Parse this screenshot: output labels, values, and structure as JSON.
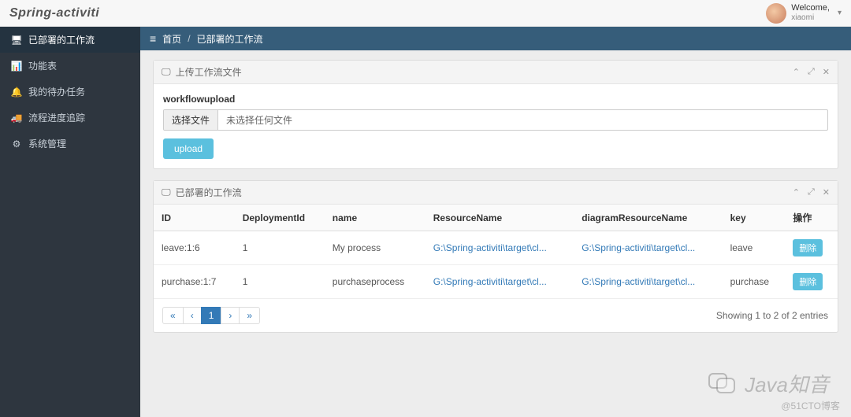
{
  "brand": "Spring-activiti",
  "user": {
    "welcome": "Welcome,",
    "name": "xiaomi"
  },
  "sidebar": {
    "items": [
      {
        "icon": "dashboard-icon",
        "glyph": "🖥",
        "label": "已部署的工作流"
      },
      {
        "icon": "chart-icon",
        "glyph": "📊",
        "label": "功能表"
      },
      {
        "icon": "bell-icon",
        "glyph": "🔔",
        "label": "我的待办任务"
      },
      {
        "icon": "truck-icon",
        "glyph": "🚚",
        "label": "流程进度追踪"
      },
      {
        "icon": "gear-icon",
        "glyph": "⚙",
        "label": "系统管理"
      }
    ]
  },
  "breadcrumb": {
    "home": "首页",
    "current": "已部署的工作流"
  },
  "uploadPanel": {
    "title": "上传工作流文件",
    "formLabel": "workflowupload",
    "chooseFile": "选择文件",
    "noFile": "未选择任何文件",
    "uploadBtn": "upload"
  },
  "tablePanel": {
    "title": "已部署的工作流",
    "headers": {
      "id": "ID",
      "deploymentId": "DeploymentId",
      "name": "name",
      "resourceName": "ResourceName",
      "diagramResourceName": "diagramResourceName",
      "key": "key",
      "action": "操作"
    },
    "rows": [
      {
        "id": "leave:1:6",
        "deploymentId": "1",
        "name": "My process",
        "resourceName": "G:\\Spring-activiti\\target\\cl...",
        "diagramResourceName": "G:\\Spring-activiti\\target\\cl...",
        "key": "leave",
        "action": "删除"
      },
      {
        "id": "purchase:1:7",
        "deploymentId": "1",
        "name": "purchaseprocess",
        "resourceName": "G:\\Spring-activiti\\target\\cl...",
        "diagramResourceName": "G:\\Spring-activiti\\target\\cl...",
        "key": "purchase",
        "action": "删除"
      }
    ],
    "pagination": {
      "first": "«",
      "prev": "‹",
      "page1": "1",
      "next": "›",
      "last": "»"
    },
    "entriesText": "Showing 1 to 2 of 2 entries"
  },
  "watermark": "Java知音",
  "watermark2": "@51CTO博客"
}
